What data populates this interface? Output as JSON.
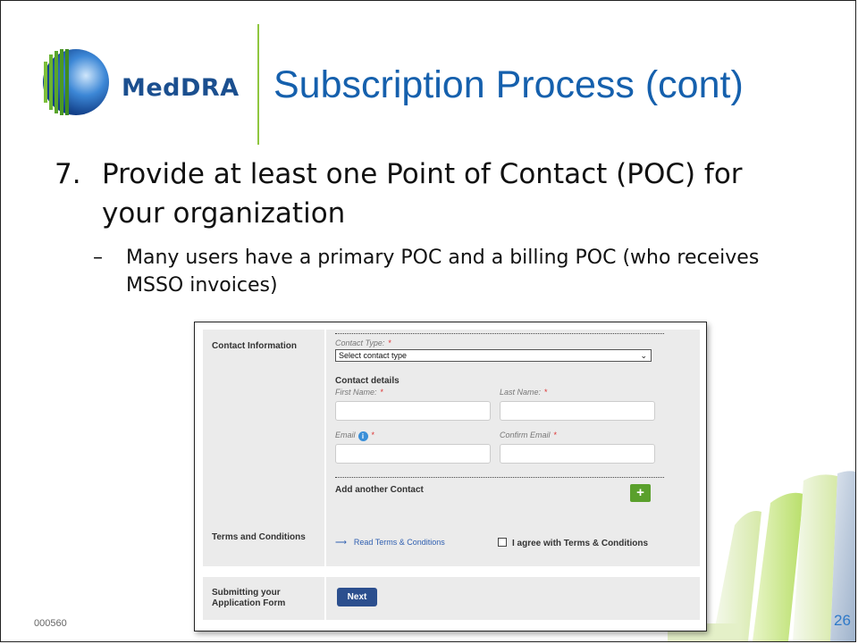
{
  "header": {
    "brand": "MedDRA",
    "title": "Subscription Process (cont)"
  },
  "bullets": {
    "main_number": "7.",
    "main_text": "Provide at least one Point of Contact (POC) for your organization",
    "sub_dash": "–",
    "sub_text": "Many users have a primary POC and a billing POC (who receives MSSO invoices)"
  },
  "form": {
    "contact_section_label": "Contact Information",
    "contact_type_label": "Contact Type:",
    "required_marker": "*",
    "contact_type_value": "Select contact type",
    "contact_details_heading": "Contact details",
    "first_name_label": "First Name:",
    "last_name_label": "Last Name:",
    "email_label": "Email",
    "confirm_email_label": "Confirm Email",
    "add_contact_label": "Add another Contact",
    "add_button_label": "+",
    "terms_section_label": "Terms and Conditions",
    "terms_link_label": "Read Terms & Conditions",
    "terms_checkbox_label": "I agree with Terms & Conditions",
    "submit_section_label": "Submitting your Application Form",
    "next_button_label": "Next"
  },
  "footer": {
    "code": "000560",
    "page_number": "26"
  },
  "colors": {
    "brand_blue": "#1b4f8f",
    "title_blue": "#1560ad",
    "accent_green": "#8fc63f",
    "button_green": "#5aa02c",
    "button_navy": "#2c4f8e"
  }
}
